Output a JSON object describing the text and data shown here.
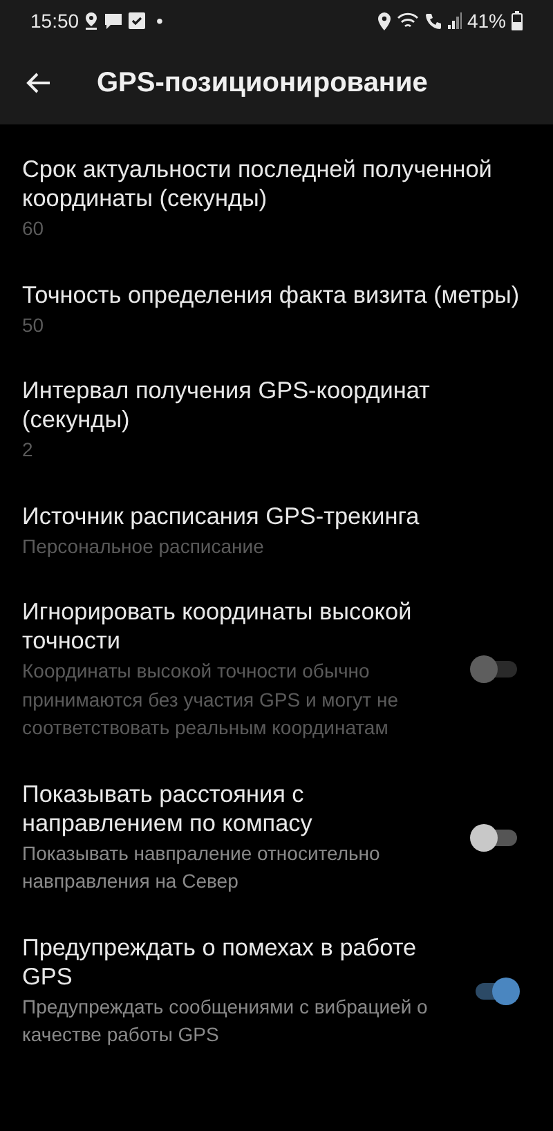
{
  "status_bar": {
    "time": "15:50",
    "dot": "•",
    "battery": "41%"
  },
  "app_bar": {
    "title": "GPS-позиционирование"
  },
  "settings": [
    {
      "kind": "value",
      "title": "Срок актуальности последней полученной координаты (секунды)",
      "summary": "60"
    },
    {
      "kind": "value",
      "title": "Точность определения факта визита (метры)",
      "summary": "50"
    },
    {
      "kind": "value",
      "title": "Интервал получения GPS-координат (секунды)",
      "summary": "2"
    },
    {
      "kind": "value",
      "title": "Источник расписания GPS-трекинга",
      "summary": "Персональное расписание"
    },
    {
      "kind": "switch",
      "title": "Игнорировать координаты высокой точности",
      "summary": "Координаты высокой точности обычно принимаются без участия GPS и могут не соответствовать реальным координатам",
      "disabled": true,
      "on": false
    },
    {
      "kind": "switch",
      "title": "Показывать расстояния с направлением по компасу",
      "summary": "Показывать навпраление относительно навправления на Север",
      "disabled": false,
      "on": false
    },
    {
      "kind": "switch",
      "title": "Предупреждать о помехах в работе GPS",
      "summary": "Предупреждать сообщениями с вибрацией о качестве работы GPS",
      "disabled": false,
      "on": true
    }
  ]
}
